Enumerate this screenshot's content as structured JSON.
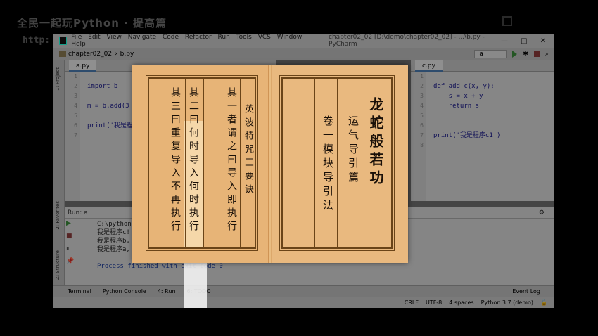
{
  "course": {
    "title": "全民一起玩Python · 提高篇",
    "url": "http:"
  },
  "ide": {
    "menu": [
      "File",
      "Edit",
      "View",
      "Navigate",
      "Code",
      "Refactor",
      "Run",
      "Tools",
      "VCS",
      "Window",
      "Help"
    ],
    "window_path": "chapter02_02 [D:\\demo\\chapter02_02] - ...\\b.py - PyCharm",
    "breadcrumb": {
      "project": "chapter02_02",
      "file": "b.py"
    },
    "run_config": "a",
    "left_tab": "a.py",
    "right_tab": "c.py",
    "left_code": {
      "line_numbers": [
        "1",
        "2",
        "3",
        "4",
        "5",
        "6",
        "7"
      ],
      "lines": [
        "",
        "import b",
        "",
        "m = b.add(3",
        "",
        "print('我是程",
        ""
      ]
    },
    "right_code": {
      "line_numbers": [
        "1",
        "2",
        "3",
        "4",
        "5",
        "6",
        "7",
        "8"
      ],
      "lines": [
        "",
        "def add_c(x, y):",
        "    s = x + y",
        "    return s",
        "",
        "",
        "print('我是程序c1')",
        ""
      ]
    },
    "run_label": "Run:",
    "run_tab": "a",
    "console": [
      "C:\\python\\",
      "我是程序c!",
      "我是程序b,",
      "我是程序a,",
      "",
      "Process finished with exit code 0"
    ],
    "bottom_tabs": [
      "Terminal",
      "Python Console",
      "4: Run",
      "6: TODO"
    ],
    "event_log": "Event Log",
    "status": [
      "CRLF",
      "UTF-8",
      "4 spaces",
      "Python 3.7 (demo)"
    ],
    "side_tabs": [
      "1: Project",
      "2: Favorites",
      "Z: Structure"
    ]
  },
  "book": {
    "left_page_columns": [
      "其一者谓之曰导入即执行",
      "其二曰何时导入何时执行",
      "其三曰重复导入不再执行",
      "英波特咒三要诀"
    ],
    "right_page": {
      "title": "龙蛇般若功",
      "subtitle": "运气导引篇",
      "chapter": "卷一模块导引法"
    }
  }
}
